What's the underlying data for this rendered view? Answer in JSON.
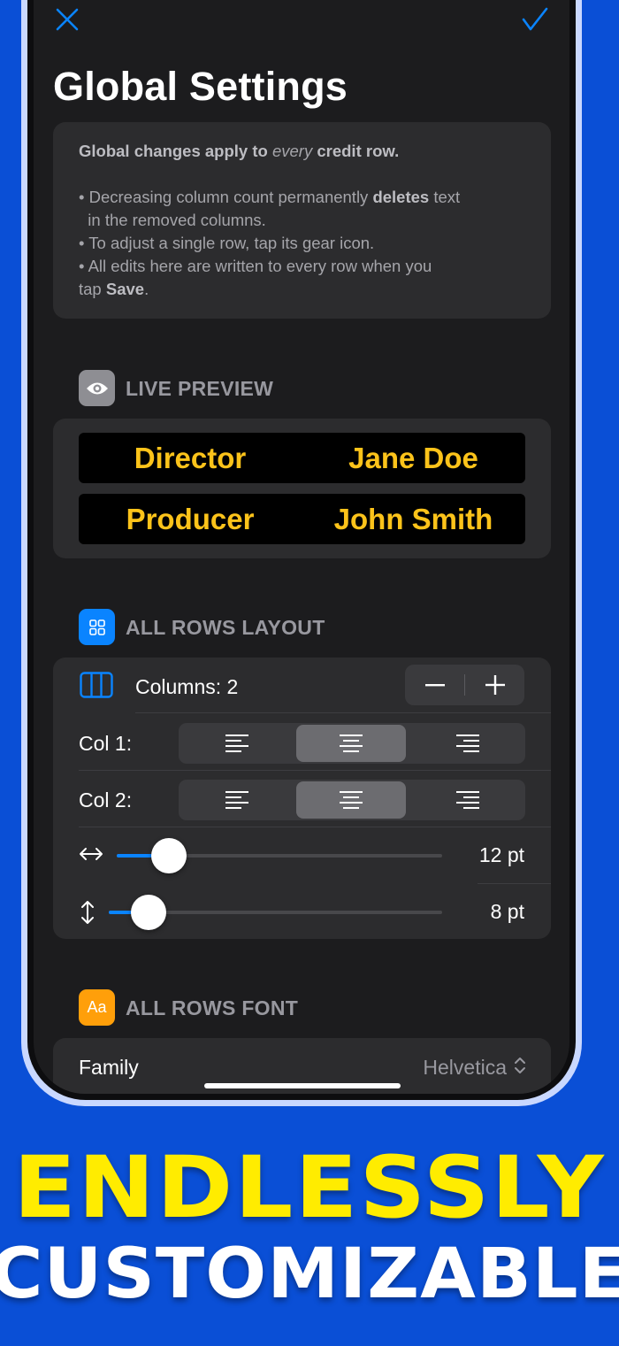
{
  "nav": {
    "close_icon": "close-icon",
    "confirm_icon": "checkmark-icon"
  },
  "title": "Global Settings",
  "info": {
    "line1_bold_a": "Global changes apply to ",
    "line1_italic": "every",
    "line1_bold_b": " credit row.",
    "bullet1_a": "• Decreasing column count permanently ",
    "bullet1_bold": "deletes",
    "bullet1_b": " text",
    "bullet1_c": "  in the removed columns.",
    "bullet2": "• To adjust a single row, tap its gear icon.",
    "bullet3_a": "• All edits here are written to every row when you",
    "bullet3_b": "tap ",
    "bullet3_bold": "Save",
    "bullet3_c": "."
  },
  "preview": {
    "section_label": "LIVE PREVIEW",
    "icon": "eye-icon",
    "rows": [
      {
        "role": "Director",
        "name": "Jane Doe"
      },
      {
        "role": "Producer",
        "name": "John Smith"
      }
    ],
    "text_color": "#fcc31a"
  },
  "layout": {
    "section_label": "ALL ROWS LAYOUT",
    "icon": "grid-icon",
    "columns_label": "Columns: 2",
    "stepper_minus": "−",
    "stepper_plus": "+",
    "col1_label": "Col 1:",
    "col2_label": "Col 2:",
    "col1_alignment": "center",
    "col2_alignment": "center",
    "horizontal_spacing": "12 pt",
    "horizontal_spacing_fraction": 0.16,
    "vertical_spacing": "8 pt",
    "vertical_spacing_fraction": 0.12
  },
  "font": {
    "section_label": "ALL ROWS FONT",
    "icon_text": "Aa",
    "family_label": "Family",
    "family_value": "Helvetica"
  },
  "headline": {
    "line1": "ENDLESSLY",
    "line2": "CUSTOMIZABLE"
  },
  "colors": {
    "background": "#0a4fd6",
    "accent": "#0a84ff",
    "headline_yellow": "#ffec00",
    "font_icon_bg": "#ff9f0a",
    "layout_icon_bg": "#0a84ff"
  }
}
